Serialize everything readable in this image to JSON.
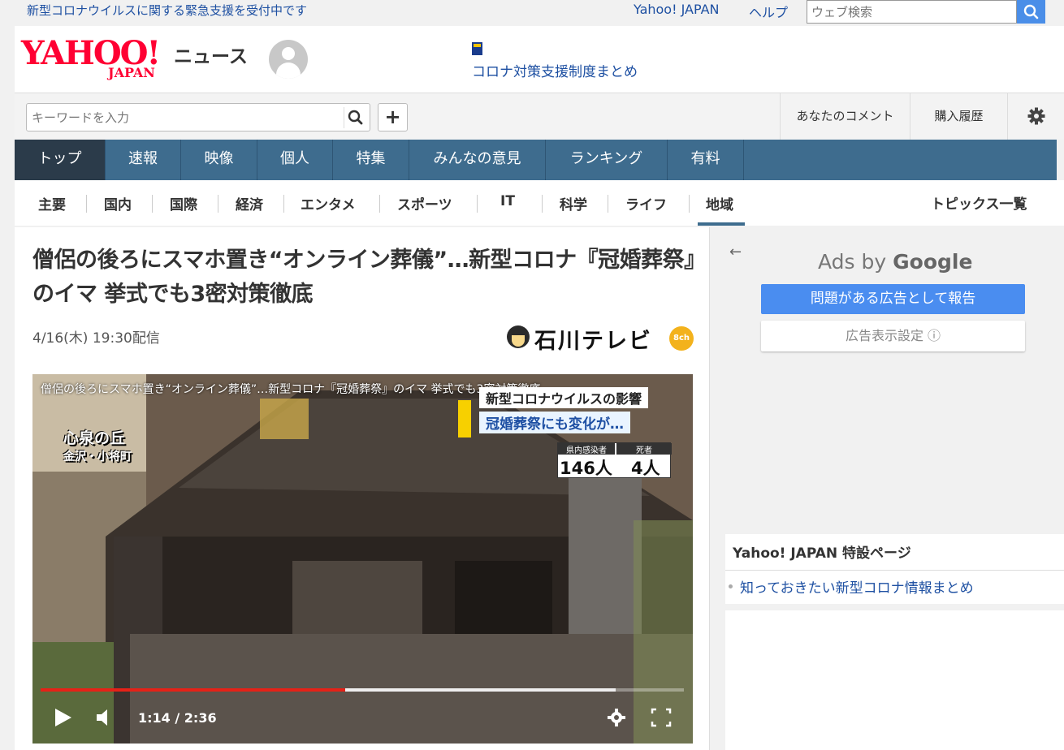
{
  "topbar": {
    "notice": "新型コロナウイルスに関する緊急支援を受付中です",
    "yahoo_japan": "Yahoo! JAPAN",
    "help": "ヘルプ",
    "web_search_placeholder": "ウェブ検索"
  },
  "header": {
    "logo_main": "YAHOO!",
    "logo_sub": "JAPAN",
    "section": "ニュース",
    "promo_link": "コロナ対策支援制度まとめ"
  },
  "search": {
    "placeholder": "キーワードを入力",
    "plus": "+",
    "your_comments": "あなたのコメント",
    "purchase_history": "購入履歴"
  },
  "main_nav": [
    {
      "label": "トップ",
      "active": true
    },
    {
      "label": "速報"
    },
    {
      "label": "映像"
    },
    {
      "label": "個人"
    },
    {
      "label": "特集"
    },
    {
      "label": "みんなの意見"
    },
    {
      "label": "ランキング"
    },
    {
      "label": "有料"
    }
  ],
  "sub_nav": {
    "items": [
      "主要",
      "国内",
      "国際",
      "経済",
      "エンタメ",
      "スポーツ",
      "IT",
      "科学",
      "ライフ",
      "地域"
    ],
    "active": "地域",
    "topics": "トピックス一覧"
  },
  "article": {
    "title": "僧侶の後ろにスマホ置き“オンライン葬儀”…新型コロナ『冠婚葬祭』のイマ 挙式でも3密対策徹底",
    "date": "4/16(木) 19:30配信",
    "source": "石川テレビ",
    "source_channel": "8ch"
  },
  "video": {
    "title": "僧侶の後ろにスマホ置き“オンライン葬儀”…新型コロナ『冠婚葬祭』のイマ 挙式でも3密対策徹底",
    "caption_line1": "新型コロナウイルスの影響",
    "caption_line2": "冠婚葬祭にも変化が…",
    "stat_label_infected": "県内感染者",
    "stat_label_deaths": "死者",
    "stat_infected": "146人",
    "stat_deaths": "4人",
    "location_name": "心泉の丘",
    "location_place": "金沢・小将町",
    "current_time": "1:14",
    "duration": "2:36",
    "timecode": "1:14 / 2:36",
    "played_fraction": 0.474,
    "loaded_fraction": 0.894
  },
  "ads": {
    "back_arrow": "←",
    "ads_by": "Ads by",
    "google": "Google",
    "report": "問題がある広告として報告",
    "settings": "広告表示設定 ⓘ"
  },
  "special": {
    "title": "Yahoo! JAPAN 特設ページ",
    "link": "知っておきたい新型コロナ情報まとめ"
  },
  "colors": {
    "nav_bg": "#3e6c8e",
    "nav_active": "#2b3b4a",
    "link": "#1e50a2",
    "brand_red": "#ff0033",
    "ad_button": "#4a8df0",
    "progress_played": "#e62117"
  }
}
